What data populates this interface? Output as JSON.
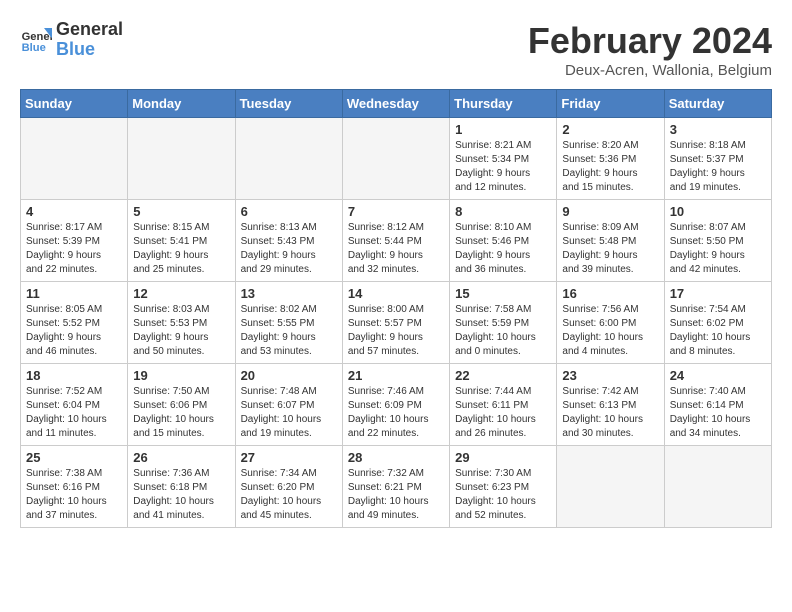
{
  "logo": {
    "line1": "General",
    "line2": "Blue"
  },
  "title": "February 2024",
  "subtitle": "Deux-Acren, Wallonia, Belgium",
  "headers": [
    "Sunday",
    "Monday",
    "Tuesday",
    "Wednesday",
    "Thursday",
    "Friday",
    "Saturday"
  ],
  "weeks": [
    [
      {
        "day": "",
        "info": ""
      },
      {
        "day": "",
        "info": ""
      },
      {
        "day": "",
        "info": ""
      },
      {
        "day": "",
        "info": ""
      },
      {
        "day": "1",
        "info": "Sunrise: 8:21 AM\nSunset: 5:34 PM\nDaylight: 9 hours\nand 12 minutes."
      },
      {
        "day": "2",
        "info": "Sunrise: 8:20 AM\nSunset: 5:36 PM\nDaylight: 9 hours\nand 15 minutes."
      },
      {
        "day": "3",
        "info": "Sunrise: 8:18 AM\nSunset: 5:37 PM\nDaylight: 9 hours\nand 19 minutes."
      }
    ],
    [
      {
        "day": "4",
        "info": "Sunrise: 8:17 AM\nSunset: 5:39 PM\nDaylight: 9 hours\nand 22 minutes."
      },
      {
        "day": "5",
        "info": "Sunrise: 8:15 AM\nSunset: 5:41 PM\nDaylight: 9 hours\nand 25 minutes."
      },
      {
        "day": "6",
        "info": "Sunrise: 8:13 AM\nSunset: 5:43 PM\nDaylight: 9 hours\nand 29 minutes."
      },
      {
        "day": "7",
        "info": "Sunrise: 8:12 AM\nSunset: 5:44 PM\nDaylight: 9 hours\nand 32 minutes."
      },
      {
        "day": "8",
        "info": "Sunrise: 8:10 AM\nSunset: 5:46 PM\nDaylight: 9 hours\nand 36 minutes."
      },
      {
        "day": "9",
        "info": "Sunrise: 8:09 AM\nSunset: 5:48 PM\nDaylight: 9 hours\nand 39 minutes."
      },
      {
        "day": "10",
        "info": "Sunrise: 8:07 AM\nSunset: 5:50 PM\nDaylight: 9 hours\nand 42 minutes."
      }
    ],
    [
      {
        "day": "11",
        "info": "Sunrise: 8:05 AM\nSunset: 5:52 PM\nDaylight: 9 hours\nand 46 minutes."
      },
      {
        "day": "12",
        "info": "Sunrise: 8:03 AM\nSunset: 5:53 PM\nDaylight: 9 hours\nand 50 minutes."
      },
      {
        "day": "13",
        "info": "Sunrise: 8:02 AM\nSunset: 5:55 PM\nDaylight: 9 hours\nand 53 minutes."
      },
      {
        "day": "14",
        "info": "Sunrise: 8:00 AM\nSunset: 5:57 PM\nDaylight: 9 hours\nand 57 minutes."
      },
      {
        "day": "15",
        "info": "Sunrise: 7:58 AM\nSunset: 5:59 PM\nDaylight: 10 hours\nand 0 minutes."
      },
      {
        "day": "16",
        "info": "Sunrise: 7:56 AM\nSunset: 6:00 PM\nDaylight: 10 hours\nand 4 minutes."
      },
      {
        "day": "17",
        "info": "Sunrise: 7:54 AM\nSunset: 6:02 PM\nDaylight: 10 hours\nand 8 minutes."
      }
    ],
    [
      {
        "day": "18",
        "info": "Sunrise: 7:52 AM\nSunset: 6:04 PM\nDaylight: 10 hours\nand 11 minutes."
      },
      {
        "day": "19",
        "info": "Sunrise: 7:50 AM\nSunset: 6:06 PM\nDaylight: 10 hours\nand 15 minutes."
      },
      {
        "day": "20",
        "info": "Sunrise: 7:48 AM\nSunset: 6:07 PM\nDaylight: 10 hours\nand 19 minutes."
      },
      {
        "day": "21",
        "info": "Sunrise: 7:46 AM\nSunset: 6:09 PM\nDaylight: 10 hours\nand 22 minutes."
      },
      {
        "day": "22",
        "info": "Sunrise: 7:44 AM\nSunset: 6:11 PM\nDaylight: 10 hours\nand 26 minutes."
      },
      {
        "day": "23",
        "info": "Sunrise: 7:42 AM\nSunset: 6:13 PM\nDaylight: 10 hours\nand 30 minutes."
      },
      {
        "day": "24",
        "info": "Sunrise: 7:40 AM\nSunset: 6:14 PM\nDaylight: 10 hours\nand 34 minutes."
      }
    ],
    [
      {
        "day": "25",
        "info": "Sunrise: 7:38 AM\nSunset: 6:16 PM\nDaylight: 10 hours\nand 37 minutes."
      },
      {
        "day": "26",
        "info": "Sunrise: 7:36 AM\nSunset: 6:18 PM\nDaylight: 10 hours\nand 41 minutes."
      },
      {
        "day": "27",
        "info": "Sunrise: 7:34 AM\nSunset: 6:20 PM\nDaylight: 10 hours\nand 45 minutes."
      },
      {
        "day": "28",
        "info": "Sunrise: 7:32 AM\nSunset: 6:21 PM\nDaylight: 10 hours\nand 49 minutes."
      },
      {
        "day": "29",
        "info": "Sunrise: 7:30 AM\nSunset: 6:23 PM\nDaylight: 10 hours\nand 52 minutes."
      },
      {
        "day": "",
        "info": ""
      },
      {
        "day": "",
        "info": ""
      }
    ]
  ]
}
